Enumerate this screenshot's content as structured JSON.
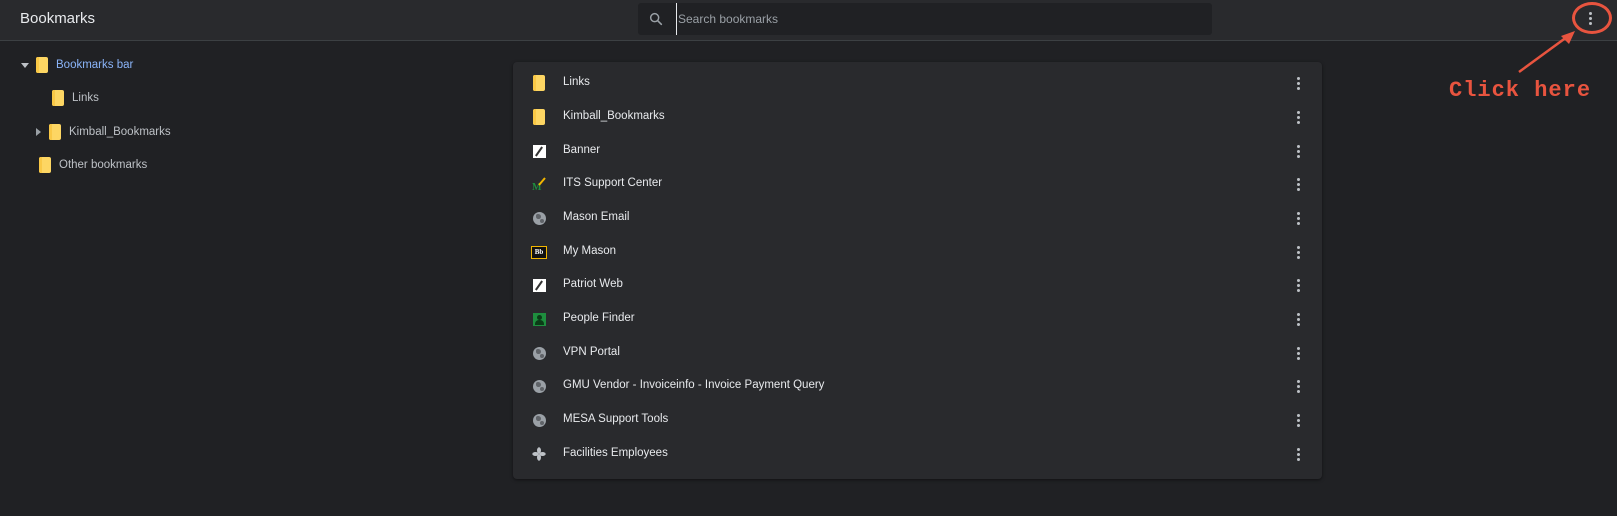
{
  "header": {
    "title": "Bookmarks",
    "search_placeholder": "Search bookmarks",
    "search_value": "",
    "menu_icon": "more-vert-icon"
  },
  "annotation": {
    "text": "Click here",
    "color": "#e8543f"
  },
  "sidebar": {
    "items": [
      {
        "label": "Bookmarks bar",
        "expanded": true,
        "selected": true
      },
      {
        "label": "Links"
      },
      {
        "label": "Kimball_Bookmarks",
        "expanded": false
      },
      {
        "label": "Other bookmarks"
      }
    ]
  },
  "list": {
    "items": [
      {
        "label": "Links",
        "icon": "folder-icon"
      },
      {
        "label": "Kimball_Bookmarks",
        "icon": "folder-icon"
      },
      {
        "label": "Banner",
        "icon": "banner-favicon"
      },
      {
        "label": "ITS Support Center",
        "icon": "its-favicon"
      },
      {
        "label": "Mason Email",
        "icon": "globe-icon"
      },
      {
        "label": "My Mason",
        "icon": "blackboard-favicon"
      },
      {
        "label": "Patriot Web",
        "icon": "banner-favicon"
      },
      {
        "label": "People Finder",
        "icon": "people-favicon"
      },
      {
        "label": "VPN Portal",
        "icon": "globe-icon"
      },
      {
        "label": "GMU Vendor - Invoiceinfo - Invoice Payment Query",
        "icon": "globe-icon"
      },
      {
        "label": "MESA Support Tools",
        "icon": "globe-icon"
      },
      {
        "label": "Facilities Employees",
        "icon": "pinwheel-favicon"
      }
    ]
  },
  "colors": {
    "background": "#202124",
    "toolbar": "#292a2d",
    "card": "#292a2d",
    "accent": "#8ab4f8",
    "folder": "#fdd663"
  }
}
